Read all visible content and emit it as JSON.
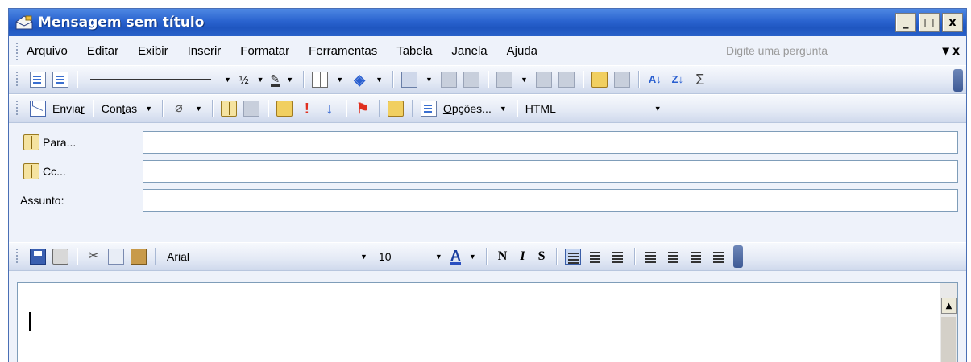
{
  "window": {
    "title": "Mensagem sem título",
    "controls": [
      "_",
      "□",
      "x"
    ]
  },
  "menu": {
    "items": [
      {
        "pre": "",
        "key": "A",
        "post": "rquivo"
      },
      {
        "pre": "",
        "key": "E",
        "post": "ditar"
      },
      {
        "pre": "E",
        "key": "x",
        "post": "ibir"
      },
      {
        "pre": "",
        "key": "I",
        "post": "nserir"
      },
      {
        "pre": "",
        "key": "F",
        "post": "ormatar"
      },
      {
        "pre": "Ferra",
        "key": "m",
        "post": "entas"
      },
      {
        "pre": "Ta",
        "key": "b",
        "post": "ela"
      },
      {
        "pre": "",
        "key": "J",
        "post": "anela"
      },
      {
        "pre": "Aj",
        "key": "u",
        "post": "da"
      }
    ],
    "ask_placeholder": "Digite uma pergunta",
    "close": "x"
  },
  "toolbar1": {
    "fraction": "½"
  },
  "toolbar2": {
    "send_pre": "Envia",
    "send_key": "r",
    "accounts_pre": "Con",
    "accounts_key": "t",
    "accounts_post": "as",
    "options_pre": "",
    "options_key": "O",
    "options_post": "pções...",
    "format": "HTML"
  },
  "fields": {
    "to_label": "Para...",
    "cc_label": "Cc...",
    "subject_label": "Assunto:",
    "to_value": "",
    "cc_value": "",
    "subject_value": ""
  },
  "toolbar3": {
    "font": "Arial",
    "size": "10",
    "color_label": "A",
    "bold": "N",
    "italic": "I",
    "underline": "S"
  },
  "body": {
    "text": ""
  },
  "colors": {
    "titlebar": "#2a63cf",
    "chrome": "#eef2fa",
    "accent": "#3a5ea8"
  }
}
